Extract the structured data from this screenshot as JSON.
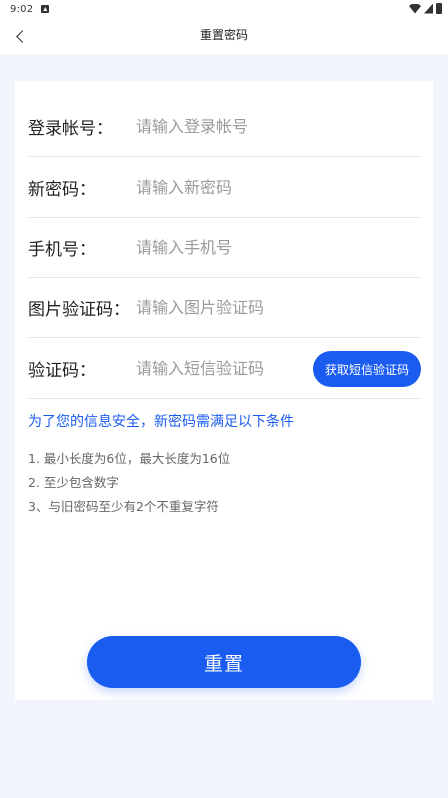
{
  "status_bar": {
    "time": "9:02"
  },
  "header": {
    "title": "重置密码"
  },
  "form": {
    "rows": [
      {
        "label": "登录帐号：",
        "placeholder": "请输入登录帐号"
      },
      {
        "label": "新密码：",
        "placeholder": "请输入新密码"
      },
      {
        "label": "手机号：",
        "placeholder": "请输入手机号"
      },
      {
        "label": "图片验证码：",
        "placeholder": "请输入图片验证码"
      },
      {
        "label": "验证码：",
        "placeholder": "请输入短信验证码"
      }
    ],
    "sms_button_label": "获取短信验证码"
  },
  "tips": {
    "title": "为了您的信息安全，新密码需满足以下条件",
    "rules": [
      "1. 最小长度为6位，最大长度为16位",
      "2. 至少包含数字",
      "3、与旧密码至少有2个不重复字符"
    ]
  },
  "reset_button_label": "重置",
  "colors": {
    "accent": "#1b5cf0",
    "page_background": "#f3f5fc",
    "card_background": "#ffffff"
  }
}
